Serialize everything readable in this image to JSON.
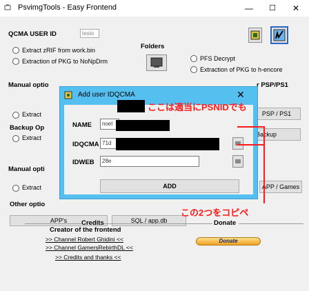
{
  "window": {
    "title": "PsvimgTools - Easy Frontend",
    "minimize": "—",
    "maximize": "☐",
    "close": "✕"
  },
  "qcma": {
    "label": "QCMA USER ID",
    "value": "teste"
  },
  "folders_label": "Folders",
  "radios": {
    "extract_zrif": "Extract zRIF from work.bin",
    "extract_pkg_nonpdrm": "Extraction of PKG to NoNpDrm",
    "pfs_decrypt": "PFS Decrypt",
    "extract_pkg_hencore": "Extraction of PKG to h-encore"
  },
  "left": {
    "manual_options_top": "Manual optio",
    "manual_options_top_suffix": "r PSP/PS1",
    "extract_1": "Extract",
    "backup_options": "Backup Op",
    "extract_2": "Extract",
    "manual_options": "Manual opti",
    "extract_3": "Extract",
    "other_options": "Other optio"
  },
  "right": {
    "psp_ps1": "PSP / PS1",
    "backup": "Backup",
    "app_games": "APP / Games"
  },
  "bottom_buttons": {
    "apps": "APP's",
    "sql": "SQL / app.db"
  },
  "credits": {
    "header": "Credits",
    "donate_header": "Donate",
    "creator": "Creator of the frontend",
    "link1": ">> Channel Robert Ghidini <<",
    "link2": ">> Channel GamersRebirthDL <<",
    "link3": ">> Credits and thanks <<",
    "donate_button": "Donate"
  },
  "dialog": {
    "title": "Add user IDQCMA",
    "close": "✕",
    "name_label": "NAME",
    "name_value": "noel",
    "idqcma_label": "IDQCMA",
    "idqcma_value": "71d",
    "idweb_label": "IDWEB",
    "idweb_value": "28e",
    "add_button": "ADD"
  },
  "annotations": {
    "top_note": "ここは適当にPSNIDでも",
    "bottom_note": "この2つをコピペ"
  },
  "colors": {
    "dialog_border": "#55c0f0",
    "annotation": "#ff1a1a"
  }
}
